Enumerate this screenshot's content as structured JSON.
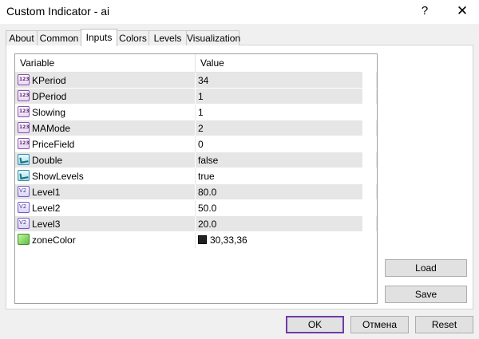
{
  "window": {
    "title": "Custom Indicator - ai",
    "help_glyph": "?",
    "close_glyph": "✕"
  },
  "tabs": [
    {
      "label": "About",
      "active": false
    },
    {
      "label": "Common",
      "active": false
    },
    {
      "label": "Inputs",
      "active": true
    },
    {
      "label": "Colors",
      "active": false
    },
    {
      "label": "Levels",
      "active": false
    },
    {
      "label": "Visualization",
      "active": false
    }
  ],
  "grid": {
    "columns": [
      "Variable",
      "Value"
    ],
    "rows": [
      {
        "icon": "int-icon",
        "name": "KPeriod",
        "value": "34"
      },
      {
        "icon": "int-icon",
        "name": "DPeriod",
        "value": "1"
      },
      {
        "icon": "int-icon",
        "name": "Slowing",
        "value": "1"
      },
      {
        "icon": "int-icon",
        "name": "MAMode",
        "value": "2"
      },
      {
        "icon": "int-icon",
        "name": "PriceField",
        "value": "0"
      },
      {
        "icon": "bool-icon",
        "name": "Double",
        "value": "false"
      },
      {
        "icon": "bool-icon",
        "name": "ShowLevels",
        "value": "true"
      },
      {
        "icon": "double-icon",
        "name": "Level1",
        "value": "80.0"
      },
      {
        "icon": "double-icon",
        "name": "Level2",
        "value": "50.0"
      },
      {
        "icon": "double-icon",
        "name": "Level3",
        "value": "20.0"
      },
      {
        "icon": "color-icon",
        "name": "zoneColor",
        "value": "30,33,36",
        "swatch": "#1e2124"
      }
    ]
  },
  "side_buttons": {
    "load": "Load",
    "save": "Save"
  },
  "footer_buttons": {
    "ok": "OK",
    "cancel": "Отмена",
    "reset": "Reset"
  },
  "colors": {
    "accent": "#6f3ba8",
    "alt_row": "#e6e6e6"
  }
}
